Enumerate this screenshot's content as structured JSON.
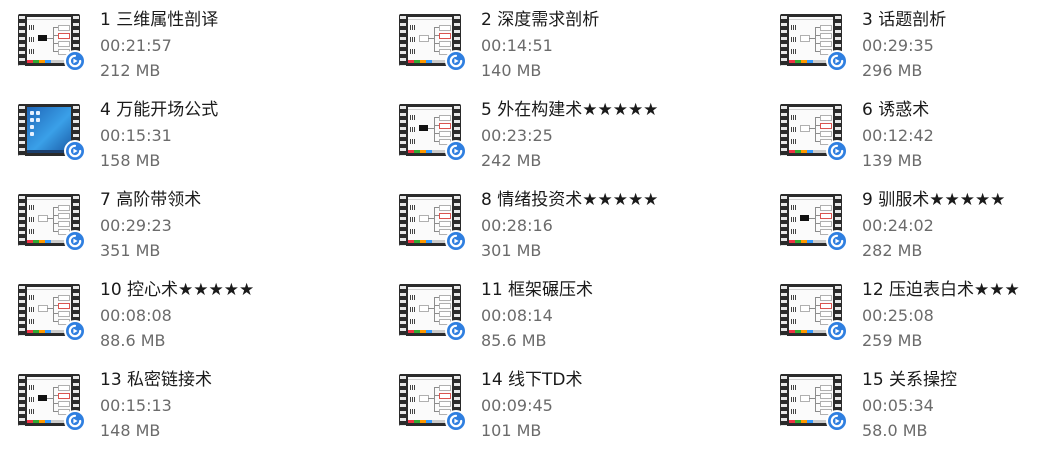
{
  "files": [
    {
      "title": "1 三维属性剖译",
      "duration": "00:21:57",
      "size": "212 MB",
      "thumb": "mindmap"
    },
    {
      "title": "2 深度需求剖析",
      "duration": "00:14:51",
      "size": "140 MB",
      "thumb": "mindmap"
    },
    {
      "title": "3 话题剖析",
      "duration": "00:29:35",
      "size": "296 MB",
      "thumb": "mindmap"
    },
    {
      "title": "4 万能开场公式",
      "duration": "00:15:31",
      "size": "158 MB",
      "thumb": "desktop"
    },
    {
      "title": "5 外在构建术★★★★★",
      "duration": "00:23:25",
      "size": "242 MB",
      "thumb": "mindmap"
    },
    {
      "title": "6 诱惑术",
      "duration": "00:12:42",
      "size": "139 MB",
      "thumb": "mindmap"
    },
    {
      "title": "7 高阶带领术",
      "duration": "00:29:23",
      "size": "351 MB",
      "thumb": "mindmap"
    },
    {
      "title": "8 情绪投资术★★★★★",
      "duration": "00:28:16",
      "size": "301 MB",
      "thumb": "mindmap"
    },
    {
      "title": "9 驯服术★★★★★",
      "duration": "00:24:02",
      "size": "282 MB",
      "thumb": "mindmap"
    },
    {
      "title": "10 控心术★★★★★",
      "duration": "00:08:08",
      "size": "88.6 MB",
      "thumb": "mindmap"
    },
    {
      "title": "11 框架碾压术",
      "duration": "00:08:14",
      "size": "85.6 MB",
      "thumb": "mindmap"
    },
    {
      "title": "12 压迫表白术★★★",
      "duration": "00:25:08",
      "size": "259 MB",
      "thumb": "mindmap"
    },
    {
      "title": "13 私密链接术",
      "duration": "00:15:13",
      "size": "148 MB",
      "thumb": "mindmap"
    },
    {
      "title": "14 线下TD术",
      "duration": "00:09:45",
      "size": "101 MB",
      "thumb": "mindmap"
    },
    {
      "title": "15 关系操控",
      "duration": "00:05:34",
      "size": "58.0 MB",
      "thumb": "mindmap"
    }
  ],
  "icons": {
    "badge": "player-app-icon",
    "thumbnail": "video-thumbnail"
  },
  "colors": {
    "badge_blue": "#2f7fe0",
    "title_text": "#1a1a1a",
    "meta_text": "#6b6b6b",
    "background": "#ffffff"
  }
}
